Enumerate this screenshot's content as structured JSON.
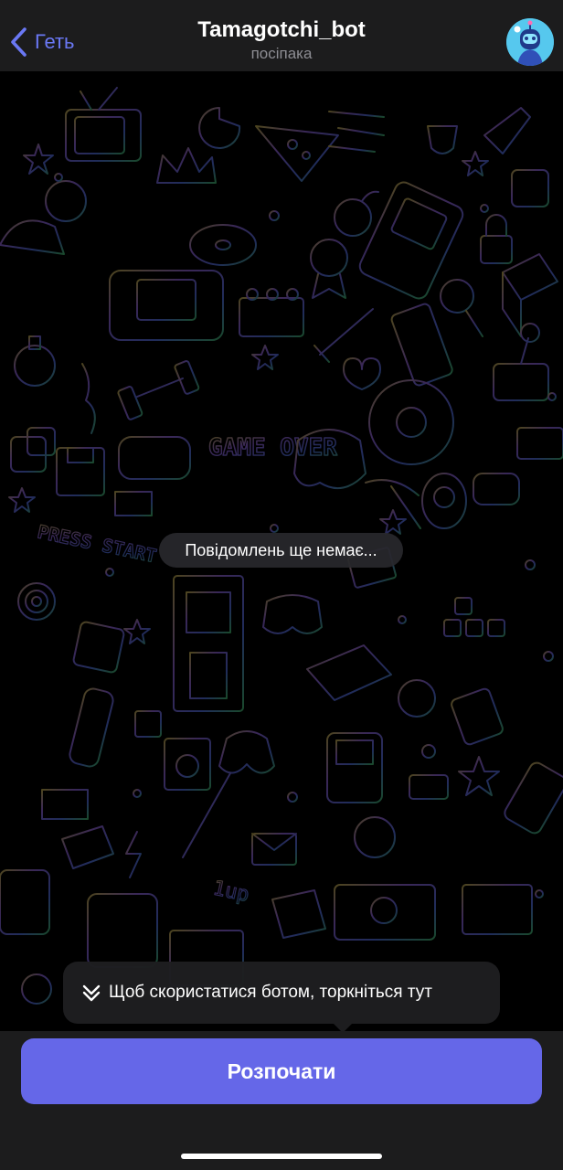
{
  "header": {
    "back_label": "Геть",
    "title": "Tamagotchi_bot",
    "subtitle": "посіпака",
    "avatar_icon": "robot-avatar-icon"
  },
  "chat": {
    "empty_text": "Повідомлень ще немає...",
    "wallpaper": "game-doodles-pattern",
    "game_over_text": "GAME OVER",
    "press_start_text": "PRESS START"
  },
  "tooltip": {
    "icon": "double-chevron-down-icon",
    "text": "Щоб скористатися ботом, торкніться тут"
  },
  "bottom": {
    "start_label": "Розпочати"
  },
  "colors": {
    "accent": "#6a78f4",
    "button": "#6567e8",
    "bar_bg": "#1c1c1d"
  }
}
